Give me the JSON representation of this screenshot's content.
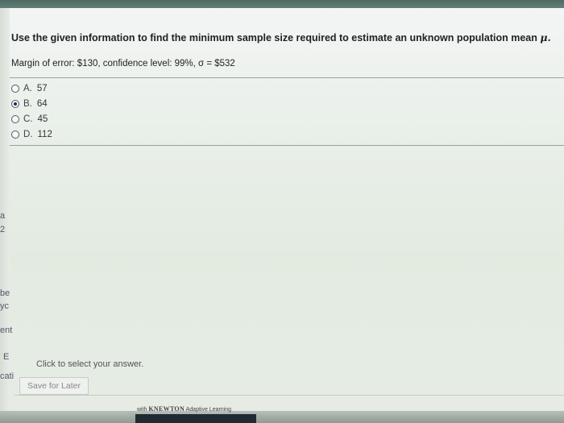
{
  "question": {
    "text": "Use the given information to find the minimum sample size required to estimate an unknown population mean",
    "symbol": "μ.",
    "given": "Margin of error: $130, confidence level: 99%, σ = $532"
  },
  "options": [
    {
      "letter": "A.",
      "value": "57",
      "selected": false
    },
    {
      "letter": "B.",
      "value": "64",
      "selected": true
    },
    {
      "letter": "C.",
      "value": "45",
      "selected": false
    },
    {
      "letter": "D.",
      "value": "112",
      "selected": false
    }
  ],
  "hint": "Click to select your answer.",
  "save_button": "Save for Later",
  "footer": {
    "prefix": "with",
    "brand": "KNEWTON",
    "suffix": "Adaptive Learning"
  },
  "edge_fragments": [
    "a",
    "2",
    "be",
    "yc",
    "ent",
    "E",
    "cati"
  ],
  "colors": {
    "selected_dot": "#1c2f48",
    "background": "#e9efe9"
  }
}
